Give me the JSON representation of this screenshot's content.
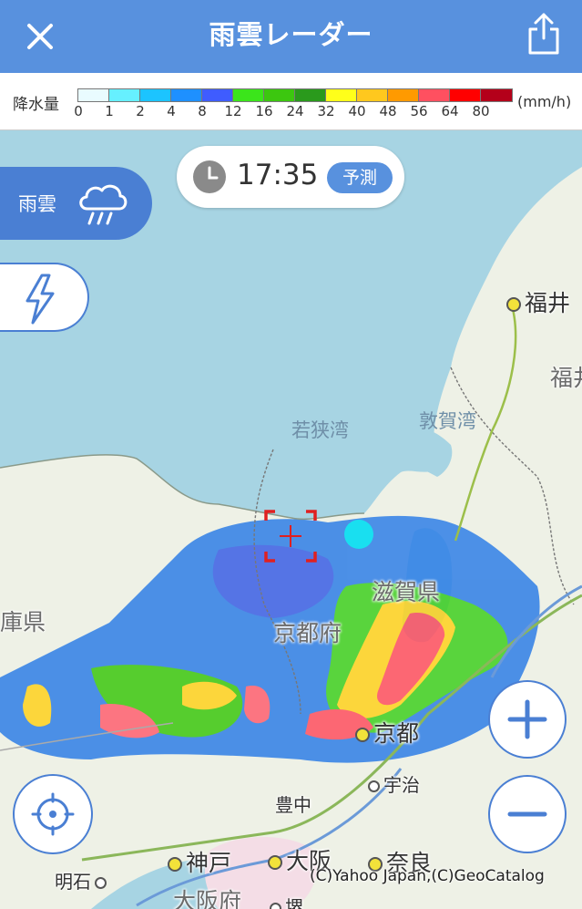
{
  "header": {
    "title": "雨雲レーダー",
    "close_icon": "close-icon",
    "share_icon": "share-icon"
  },
  "legend": {
    "label": "降水量",
    "unit": "(mm/h)",
    "colors": [
      "#e9fbff",
      "#66f0ff",
      "#1cc4ff",
      "#1e90ff",
      "#3f5cff",
      "#3be51b",
      "#3cc70f",
      "#2a9a1c",
      "#ffff1a",
      "#ffc81e",
      "#ff9a00",
      "#ff5060",
      "#ff0000",
      "#b4001a"
    ],
    "ticks": [
      "0",
      "1",
      "2",
      "4",
      "8",
      "12",
      "16",
      "24",
      "32",
      "40",
      "48",
      "56",
      "64",
      "80"
    ]
  },
  "time_control": {
    "time": "17:35",
    "badge": "予測"
  },
  "layer_buttons": {
    "rain_label": "雨雲"
  },
  "map_labels": {
    "fukui": "福井",
    "fukui_pref": "福井",
    "wakasa_bay": "若狭湾",
    "tsuruga_bay": "敦賀湾",
    "shiga": "滋賀県",
    "kyoto_pref": "京都府",
    "hyogo": "庫県",
    "kyoto": "京都",
    "uji": "宇治",
    "toyonaka": "豊中",
    "kobe": "神戸",
    "osaka": "大阪",
    "nara": "奈良",
    "akashi": "明石",
    "osaka_pref": "大阪府",
    "sakai": "堺"
  },
  "credit": "(C)Yahoo Japan,(C)GeoCatalog"
}
